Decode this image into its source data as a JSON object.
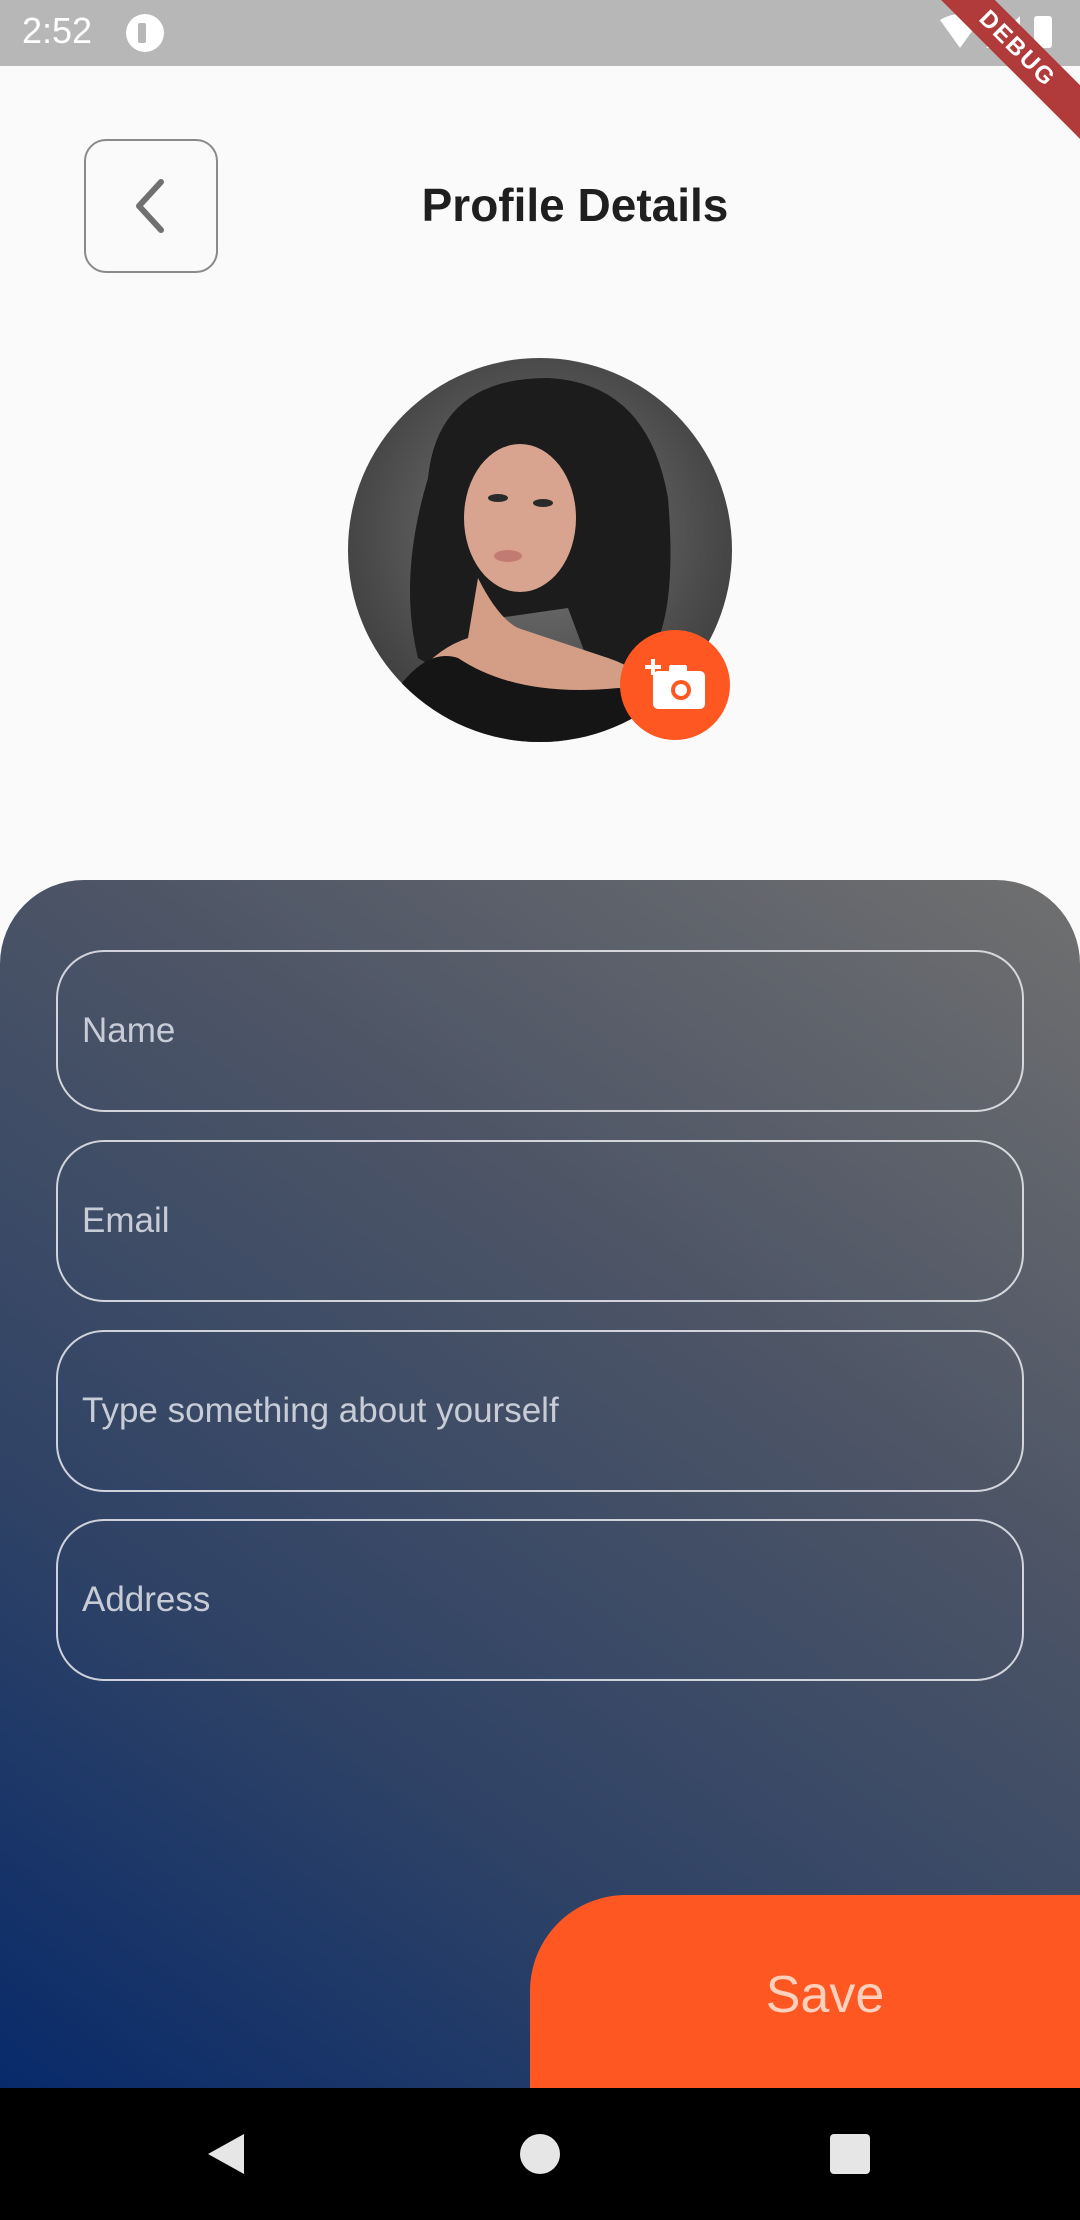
{
  "status_bar": {
    "time": "2:52",
    "icons": [
      "app-notification-icon",
      "wifi-icon",
      "signal-icon",
      "battery-icon"
    ],
    "debug_banner": "DEBUG"
  },
  "header": {
    "title": "Profile Details",
    "back_icon": "chevron-left-icon"
  },
  "profile": {
    "avatar": "profile-photo",
    "camera_icon": "add-photo-icon",
    "accent_color": "#ff5722"
  },
  "form": {
    "fields": [
      {
        "placeholder": "Name",
        "value": ""
      },
      {
        "placeholder": "Email",
        "value": ""
      },
      {
        "placeholder": "Type something about yourself",
        "value": ""
      },
      {
        "placeholder": "Address",
        "value": ""
      }
    ],
    "save_label": "Save"
  },
  "navigation": {
    "buttons": [
      "back-triangle-icon",
      "home-circle-icon",
      "recents-square-icon"
    ]
  }
}
